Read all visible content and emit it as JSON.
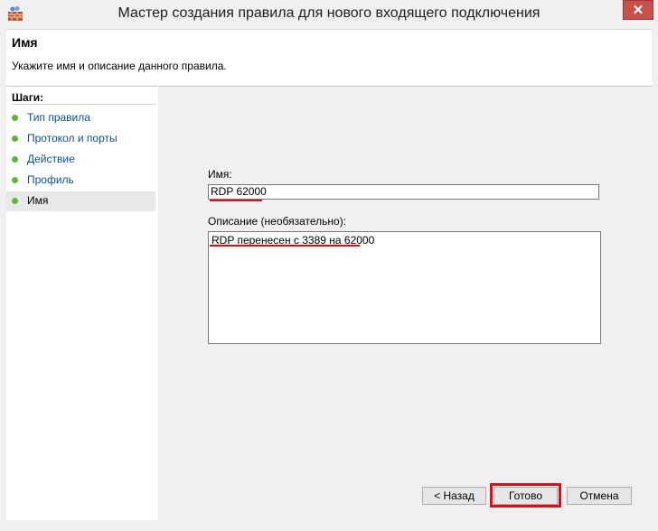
{
  "window": {
    "title": "Мастер создания правила для нового входящего подключения",
    "close_glyph": "✕"
  },
  "header": {
    "title": "Имя",
    "description": "Укажите имя и описание данного правила."
  },
  "steps": {
    "title": "Шаги:",
    "items": [
      {
        "label": "Тип правила"
      },
      {
        "label": "Протокол и порты"
      },
      {
        "label": "Действие"
      },
      {
        "label": "Профиль"
      },
      {
        "label": "Имя",
        "current": true
      }
    ]
  },
  "form": {
    "name_label": "Имя:",
    "name_value": "RDP 62000",
    "description_label": "Описание (необязательно):",
    "description_value": "RDP перенесен с 3389 на 62000"
  },
  "buttons": {
    "back": "< Назад",
    "finish": "Готово",
    "cancel": "Отмена"
  },
  "colors": {
    "highlight_red": "#d2121a",
    "step_done_green": "#5fb43c",
    "link_blue": "#0b4f8a",
    "close_button": "#c7504b"
  },
  "icons": {
    "app": "firewall-wall-icon",
    "close": "close-icon",
    "step": "green-dot-icon"
  }
}
